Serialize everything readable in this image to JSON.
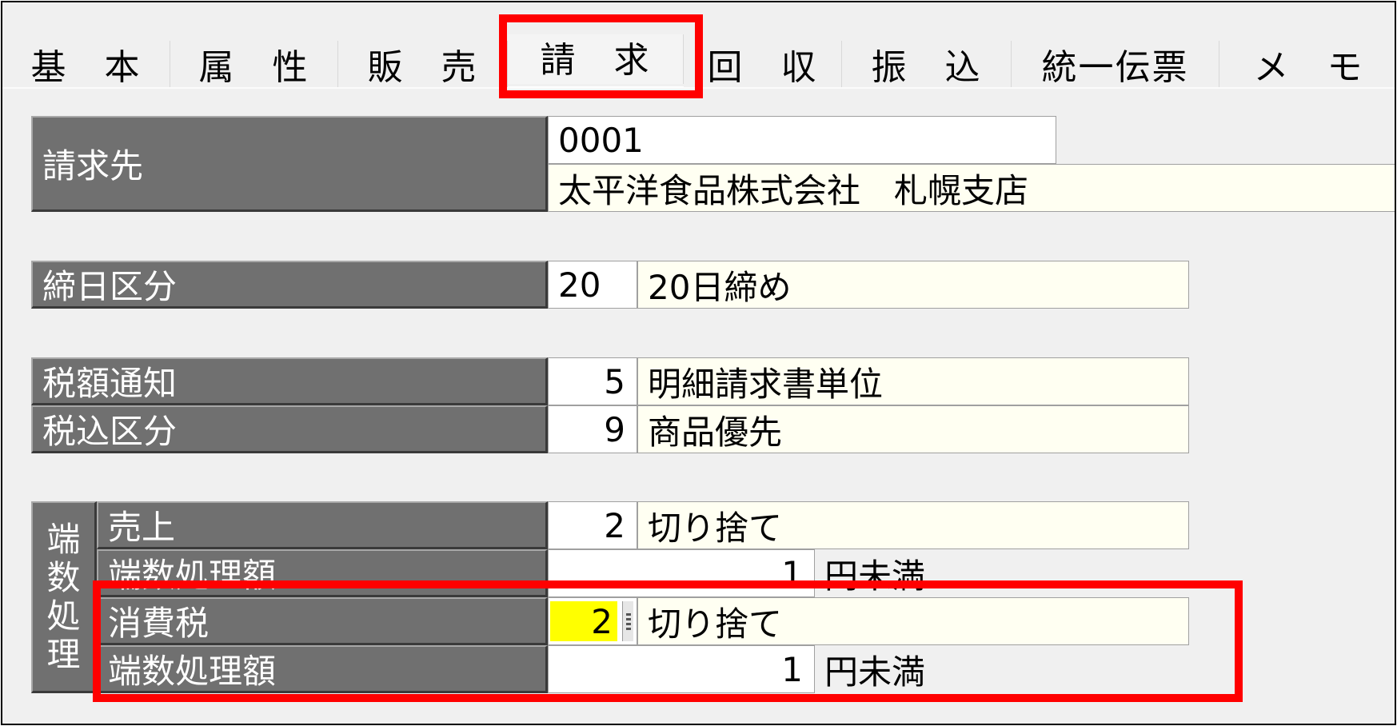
{
  "tabs": [
    {
      "label": "基　本",
      "active": false
    },
    {
      "label": "属　性",
      "active": false
    },
    {
      "label": "販　売",
      "active": false
    },
    {
      "label": "請　求",
      "active": true
    },
    {
      "label": "回　収",
      "active": false
    },
    {
      "label": "振　込",
      "active": false
    },
    {
      "label": "統一伝票",
      "active": false
    },
    {
      "label": "メ　モ",
      "active": false
    }
  ],
  "billing_to": {
    "label": "請求先",
    "code": "0001",
    "name": "太平洋食品株式会社　札幌支店"
  },
  "closing_day": {
    "label": "締日区分",
    "code": "20",
    "text": "20日締め"
  },
  "tax_notice": {
    "label": "税額通知",
    "code": "5",
    "text": "明細請求書単位"
  },
  "tax_included": {
    "label": "税込区分",
    "code": "9",
    "text": "商品優先"
  },
  "rounding": {
    "group_label": "端数処理",
    "sales": {
      "label": "売上",
      "code": "2",
      "text": "切り捨て"
    },
    "sales_amount": {
      "label": "端数処理額",
      "value": "1",
      "unit": "円未満"
    },
    "consumption_tax": {
      "label": "消費税",
      "code": "2",
      "text": "切り捨て"
    },
    "tax_amount": {
      "label": "端数処理額",
      "value": "1",
      "unit": "円未満"
    }
  },
  "colors": {
    "highlight": "#ff0000",
    "active_input": "#ffff00",
    "label_bg": "#707070"
  }
}
